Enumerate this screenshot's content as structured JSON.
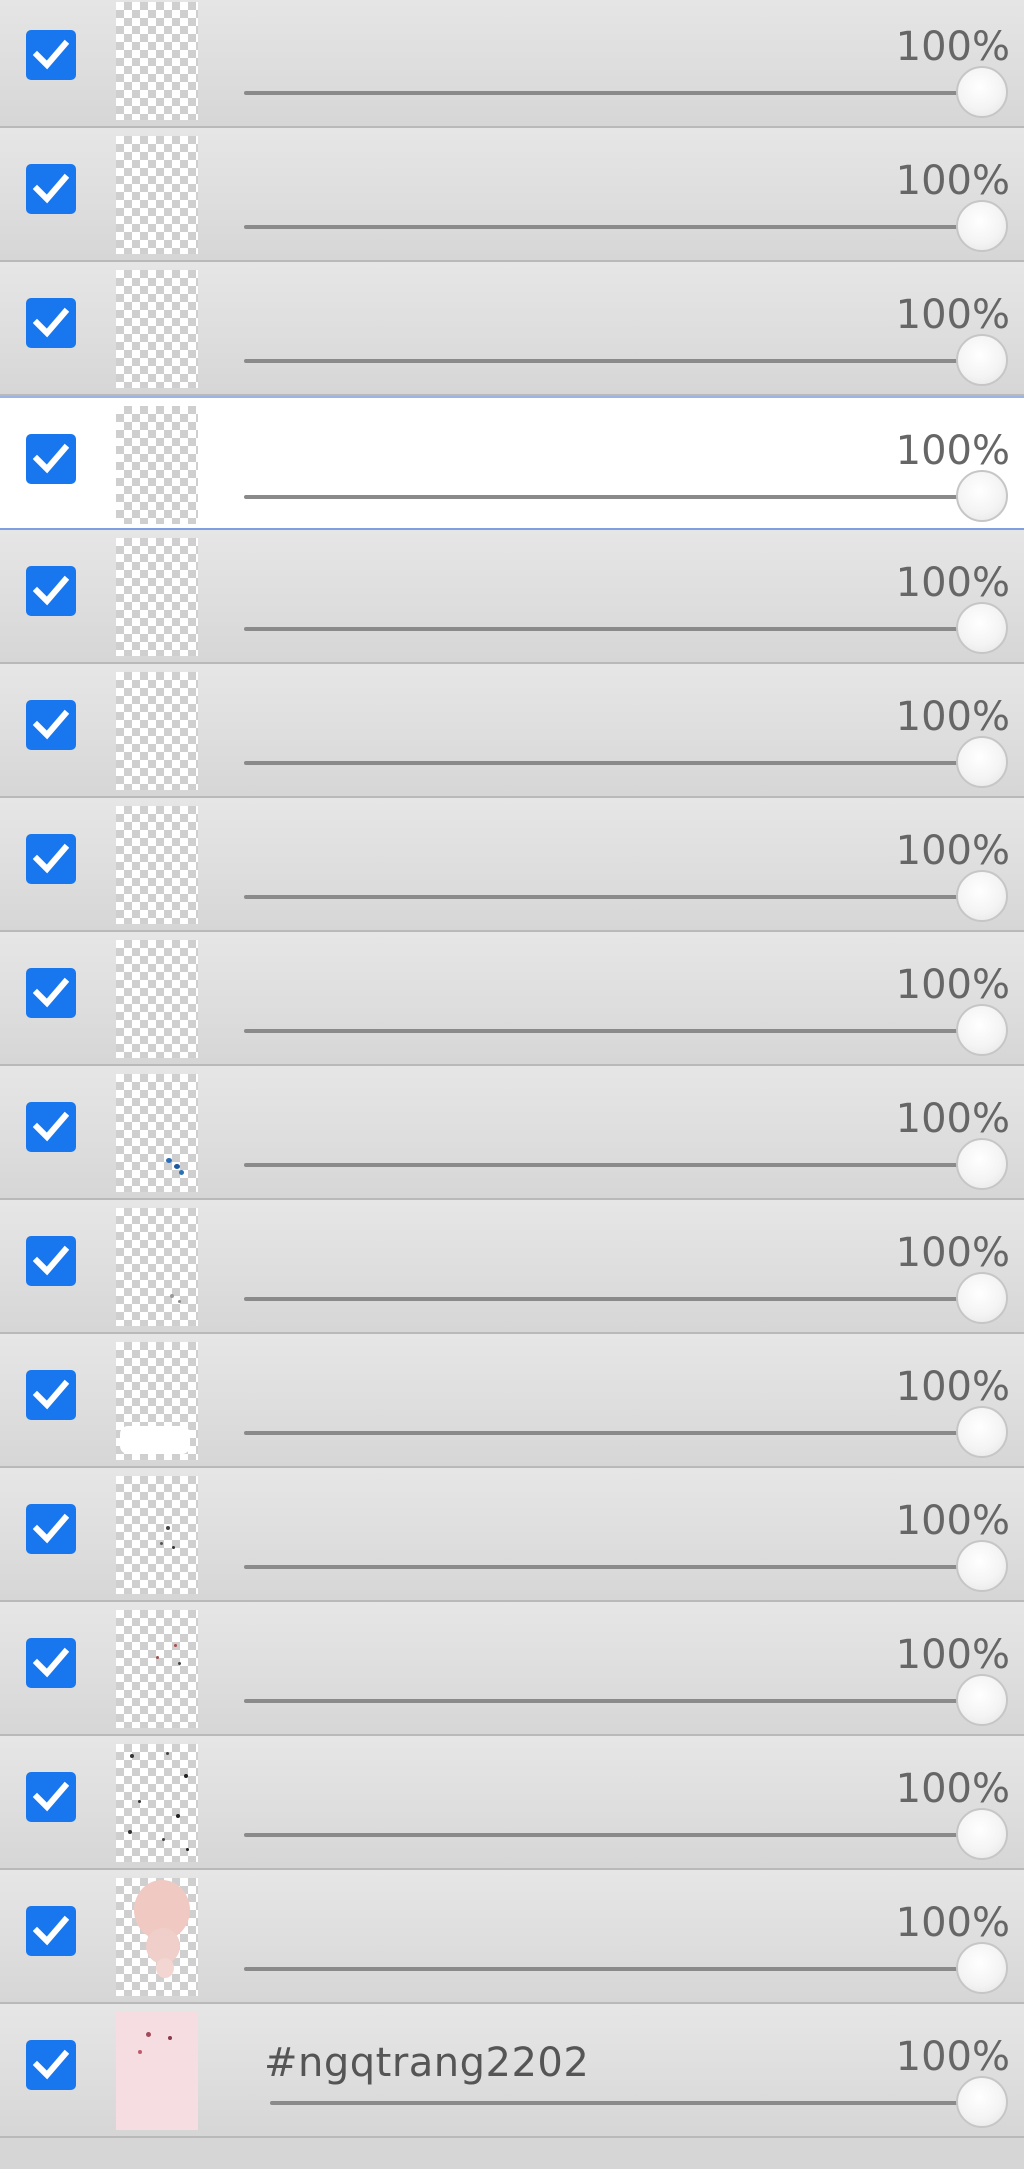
{
  "layers_panel": {
    "layers": [
      {
        "name": "",
        "opacity_label": "100%",
        "opacity": 1.0,
        "visible": true,
        "selected": false,
        "thumb": "blank"
      },
      {
        "name": "",
        "opacity_label": "100%",
        "opacity": 1.0,
        "visible": true,
        "selected": false,
        "thumb": "blank"
      },
      {
        "name": "",
        "opacity_label": "100%",
        "opacity": 1.0,
        "visible": true,
        "selected": false,
        "thumb": "blank"
      },
      {
        "name": "",
        "opacity_label": "100%",
        "opacity": 1.0,
        "visible": true,
        "selected": true,
        "thumb": "blank"
      },
      {
        "name": "",
        "opacity_label": "100%",
        "opacity": 1.0,
        "visible": true,
        "selected": false,
        "thumb": "blank"
      },
      {
        "name": "",
        "opacity_label": "100%",
        "opacity": 1.0,
        "visible": true,
        "selected": false,
        "thumb": "blank"
      },
      {
        "name": "",
        "opacity_label": "100%",
        "opacity": 1.0,
        "visible": true,
        "selected": false,
        "thumb": "blank"
      },
      {
        "name": "",
        "opacity_label": "100%",
        "opacity": 1.0,
        "visible": true,
        "selected": false,
        "thumb": "blank"
      },
      {
        "name": "",
        "opacity_label": "100%",
        "opacity": 1.0,
        "visible": true,
        "selected": false,
        "thumb": "blue-stroke"
      },
      {
        "name": "",
        "opacity_label": "100%",
        "opacity": 1.0,
        "visible": true,
        "selected": false,
        "thumb": "faint-marks"
      },
      {
        "name": "",
        "opacity_label": "100%",
        "opacity": 1.0,
        "visible": true,
        "selected": false,
        "thumb": "white-patch"
      },
      {
        "name": "",
        "opacity_label": "100%",
        "opacity": 1.0,
        "visible": true,
        "selected": false,
        "thumb": "dark-dots"
      },
      {
        "name": "",
        "opacity_label": "100%",
        "opacity": 1.0,
        "visible": true,
        "selected": false,
        "thumb": "red-dots"
      },
      {
        "name": "",
        "opacity_label": "100%",
        "opacity": 1.0,
        "visible": true,
        "selected": false,
        "thumb": "scattered-dots"
      },
      {
        "name": "",
        "opacity_label": "100%",
        "opacity": 1.0,
        "visible": true,
        "selected": false,
        "thumb": "pink-shape"
      },
      {
        "name": "#ngqtrang2202",
        "opacity_label": "100%",
        "opacity": 1.0,
        "visible": true,
        "selected": false,
        "thumb": "pink-fill"
      }
    ]
  },
  "icons": {
    "visibility": "checkmark-icon",
    "slider_handle": "slider-handle"
  },
  "colors": {
    "checkbox": "#1877ee",
    "selected_row": "#ffffff",
    "selected_border": "#7f9fe3",
    "row": "#dddddd"
  }
}
